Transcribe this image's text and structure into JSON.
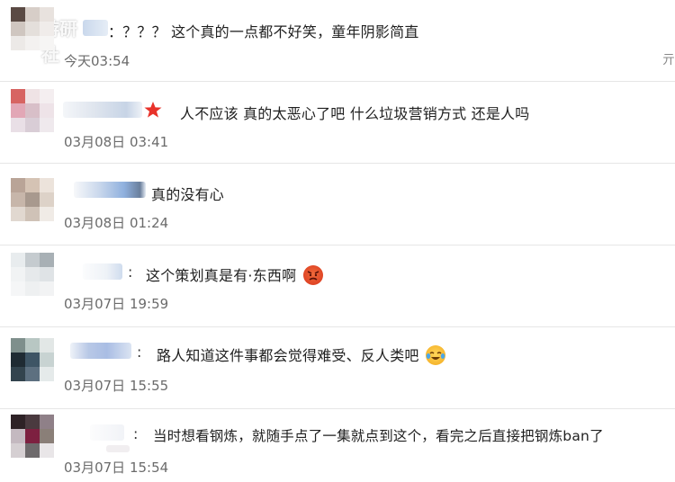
{
  "watermark": {
    "text": "游研社"
  },
  "comments": [
    {
      "text": "：？？？ 这个真的一点都不好笑，童年阴影简直",
      "time": "今天03:54"
    },
    {
      "text": "人不应该 真的太恶心了吧 什么垃圾营销方式 还是人吗",
      "time": "03月08日 03:41"
    },
    {
      "text": "真的没有心",
      "time": "03月08日 01:24"
    },
    {
      "text": "这个策划真是有·东西啊",
      "time": "03月07日 19:59"
    },
    {
      "text": "路人知道这件事都会觉得难受、反人类吧",
      "time": "03月07日 15:55"
    },
    {
      "text": "当时想看钢炼，就随手点了一集就点到这个，看完之后直接把钢炼ban了",
      "time": "03月07日 15:54"
    }
  ],
  "icons": [
    "star-icon",
    "angry-face-emoji",
    "laughing-crying-emoji"
  ],
  "colors": {
    "time": "#6b6b6b",
    "separator": "#e6e6e6",
    "star": "#e8322a"
  }
}
